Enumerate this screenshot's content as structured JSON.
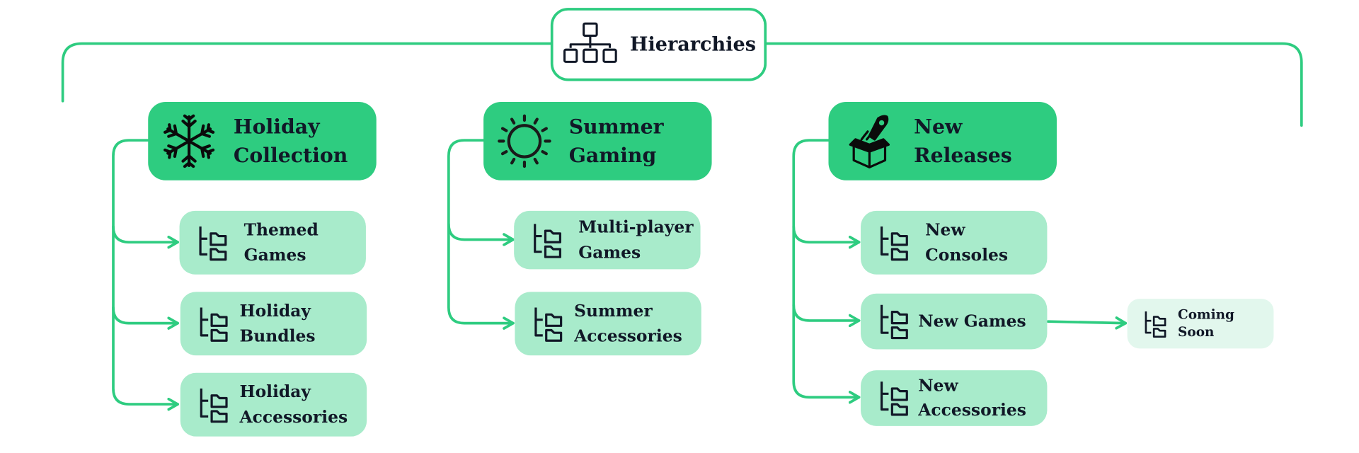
{
  "diagram": {
    "root": {
      "label": "Hierarchies",
      "icon": "hierarchy-icon"
    },
    "colors": {
      "accent": "#2ecc80",
      "child_fill": "#a8ebcb",
      "leaf_fill": "#e2f7ed",
      "text": "#111827"
    },
    "groups": [
      {
        "label_line1": "Holiday",
        "label_line2": "Collection",
        "icon": "snowflake-icon",
        "children": [
          {
            "line1": "Themed",
            "line2": "Games"
          },
          {
            "line1": "Holiday",
            "line2": "Bundles"
          },
          {
            "line1": "Holiday",
            "line2": "Accessories"
          }
        ]
      },
      {
        "label_line1": "Summer",
        "label_line2": "Gaming",
        "icon": "sun-icon",
        "children": [
          {
            "line1": "Multi-player",
            "line2": "Games"
          },
          {
            "line1": "Summer",
            "line2": "Accessories"
          }
        ]
      },
      {
        "label_line1": "New",
        "label_line2": "Releases",
        "icon": "rocket-box-icon",
        "children": [
          {
            "line1": "New",
            "line2": "Consoles"
          },
          {
            "line1": "New Games",
            "line2": ""
          },
          {
            "line1": "New",
            "line2": "Accessories"
          }
        ]
      }
    ],
    "leaf": {
      "label": "Coming Soon",
      "parent": "New Games"
    }
  }
}
